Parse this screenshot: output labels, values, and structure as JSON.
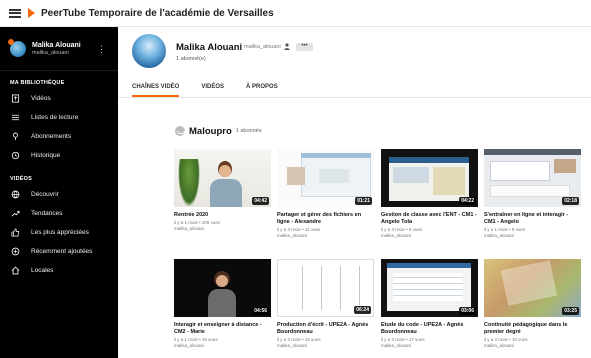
{
  "header": {
    "title": "PeerTube Temporaire de l'académie de Versailles"
  },
  "sidebar": {
    "user": {
      "name": "Malika Alouani",
      "handle": "malika_alouani",
      "more": "⋮"
    },
    "library_title": "MA BIBLIOTHÈQUE",
    "library_items": [
      {
        "label": "Vidéos",
        "icon": "upload-icon"
      },
      {
        "label": "Listes de lecture",
        "icon": "playlist-icon"
      },
      {
        "label": "Abonnements",
        "icon": "subscriptions-icon"
      },
      {
        "label": "Historique",
        "icon": "history-icon"
      }
    ],
    "videos_title": "VIDÉOS",
    "video_items": [
      {
        "label": "Découvrir",
        "icon": "globe-icon"
      },
      {
        "label": "Tendances",
        "icon": "trending-icon"
      },
      {
        "label": "Les plus appréciées",
        "icon": "thumbs-up-icon"
      },
      {
        "label": "Récemment ajoutées",
        "icon": "plus-circle-icon"
      },
      {
        "label": "Locales",
        "icon": "home-icon"
      }
    ]
  },
  "account": {
    "name": "Malika Alouani",
    "handle": "malika_alouani",
    "more_label": "•••",
    "subscribers": "1 abonné(e)",
    "tabs": [
      {
        "label": "CHAÎNES VIDÉO",
        "active": true
      },
      {
        "label": "VIDÉOS",
        "active": false
      },
      {
        "label": "À PROPOS",
        "active": false
      }
    ]
  },
  "channel": {
    "name": "Maloupro",
    "subscribers": "1 abonnée"
  },
  "videos": [
    {
      "title": "Rentrée 2020",
      "meta": "il y a 1 mois • 205 vues",
      "author": "malika_alouani",
      "duration": "04:42"
    },
    {
      "title": "Partager et gérer des fichiers en ligne - Alexandre",
      "meta": "il y a 3 mois • 11 vues",
      "author": "malika_alouani",
      "duration": "01:21"
    },
    {
      "title": "Gestion de classe avec l'ENT - CM1 - Angelo Tola",
      "meta": "il y a 3 mois • 8 vues",
      "author": "malika_alouani",
      "duration": "04:22"
    },
    {
      "title": "S'entraîner en ligne et interagir - CM1 - Angelo",
      "meta": "il y a 1 mois • 9 vues",
      "author": "malika_alouani",
      "duration": "02:18"
    },
    {
      "title": "Interagir et enseigner à distance - CM2 - Marie",
      "meta": "il y a 1 mois • 19 vues",
      "author": "malika_alouani",
      "duration": "04:56"
    },
    {
      "title": "Production d'écrit - UPE2A - Agnès Bourdonneau",
      "meta": "il y a 3 mois • 15 vues",
      "author": "malika_alouani",
      "duration": "06:24"
    },
    {
      "title": "Etude du code - UPE2A - Agnès Bourdonneau",
      "meta": "il y a 3 mois • 17 vues",
      "author": "malika_alouani",
      "duration": "03:06"
    },
    {
      "title": "Continuité pédagogique dans le premier degré",
      "meta": "il y a 3 mois • 10 vues",
      "author": "malika_alouani",
      "duration": "03:25"
    }
  ],
  "colors": {
    "accent": "#f2690d",
    "sidebar_bg": "#000000"
  }
}
